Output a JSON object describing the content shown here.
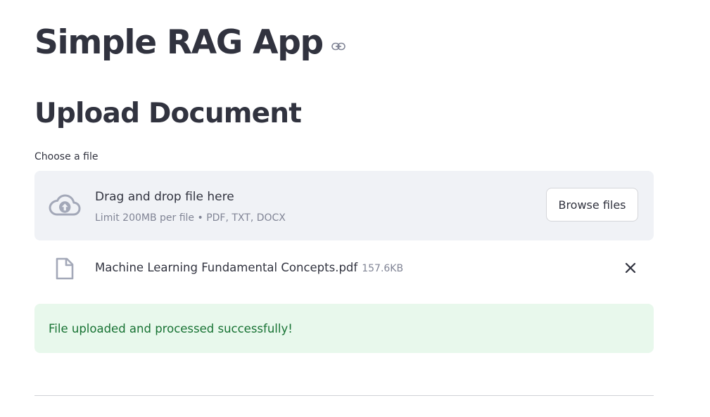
{
  "app": {
    "title": "Simple RAG App"
  },
  "upload_section": {
    "heading": "Upload Document",
    "field_label": "Choose a file",
    "dropzone": {
      "title": "Drag and drop file here",
      "limit_text": "Limit 200MB per file • PDF, TXT, DOCX",
      "browse_label": "Browse files"
    },
    "uploaded_file": {
      "name": "Machine Learning Fundamental Concepts.pdf",
      "size": "157.6KB"
    },
    "status_message": "File uploaded and processed successfully!"
  },
  "icons": {
    "anchor": "link-icon",
    "upload": "cloud-upload-icon",
    "file": "file-icon",
    "remove": "close-icon"
  },
  "colors": {
    "text": "#31333f",
    "muted": "#808495",
    "dropzone_bg": "#f0f2f6",
    "success_bg": "#e8f8ec",
    "success_text": "#177233"
  }
}
